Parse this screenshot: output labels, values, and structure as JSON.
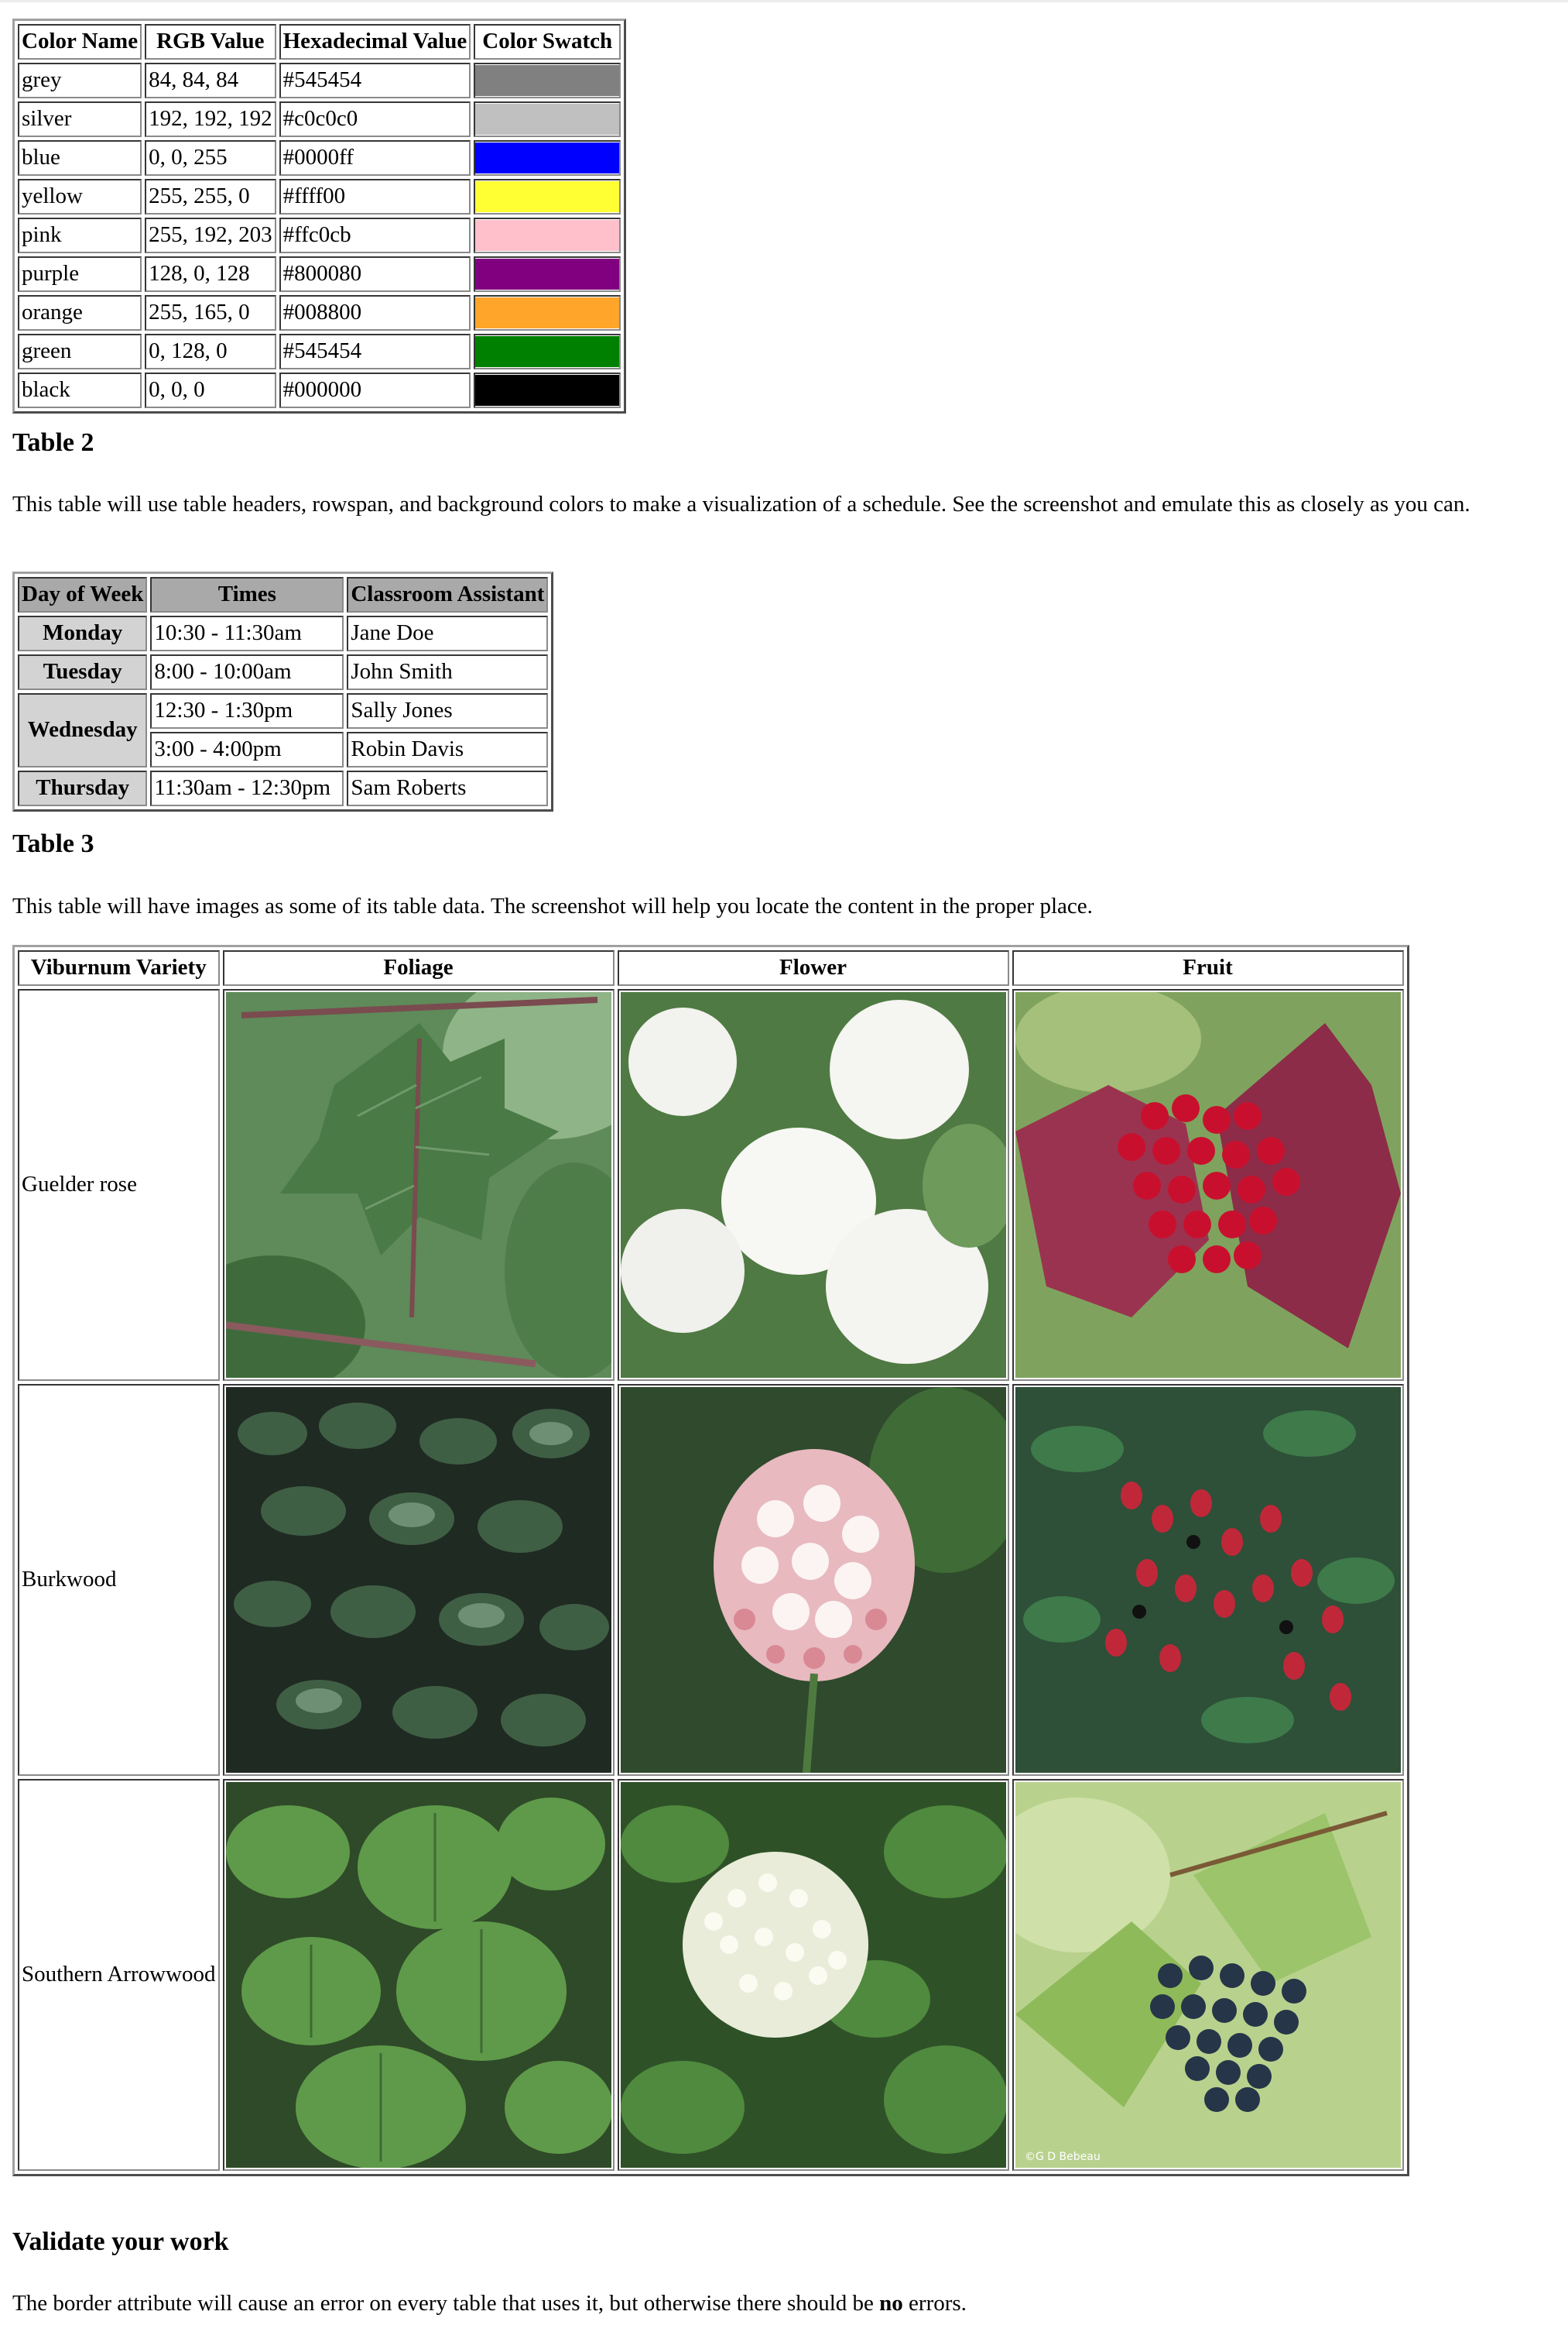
{
  "color_table": {
    "headers": [
      "Color Name",
      "RGB Value",
      "Hexadecimal Value",
      "Color Swatch"
    ],
    "rows": [
      {
        "name": "grey",
        "rgb": "84, 84, 84",
        "hex": "#545454",
        "swatch": "#808080"
      },
      {
        "name": "silver",
        "rgb": "192, 192, 192",
        "hex": "#c0c0c0",
        "swatch": "#c0c0c0"
      },
      {
        "name": "blue",
        "rgb": "0, 0, 255",
        "hex": "#0000ff",
        "swatch": "#0000ff"
      },
      {
        "name": "yellow",
        "rgb": "255, 255, 0",
        "hex": "#ffff00",
        "swatch": "#ffff33"
      },
      {
        "name": "pink",
        "rgb": "255, 192, 203",
        "hex": "#ffc0cb",
        "swatch": "#ffc0cb"
      },
      {
        "name": "purple",
        "rgb": "128, 0, 128",
        "hex": "#800080",
        "swatch": "#800080"
      },
      {
        "name": "orange",
        "rgb": "255, 165, 0",
        "hex": "#008800",
        "swatch": "#ffa52a"
      },
      {
        "name": "green",
        "rgb": "0, 128, 0",
        "hex": "#545454",
        "swatch": "#008000"
      },
      {
        "name": "black",
        "rgb": "0, 0, 0",
        "hex": "#000000",
        "swatch": "#000000"
      }
    ]
  },
  "table2": {
    "heading": "Table 2",
    "description": "This table will use table headers, rowspan, and background colors to make a visualization of a schedule. See the screenshot and emulate this as closely as you can.",
    "headers": [
      "Day of Week",
      "Times",
      "Classroom Assistant"
    ],
    "days": {
      "monday": "Monday",
      "tuesday": "Tuesday",
      "wednesday": "Wednesday",
      "thursday": "Thursday"
    },
    "rows": [
      {
        "time": "10:30 - 11:30am",
        "assistant": "Jane Doe"
      },
      {
        "time": "8:00 - 10:00am",
        "assistant": "John Smith"
      },
      {
        "time": "12:30 - 1:30pm",
        "assistant": "Sally Jones"
      },
      {
        "time": "3:00 - 4:00pm",
        "assistant": "Robin Davis"
      },
      {
        "time": "11:30am - 12:30pm",
        "assistant": "Sam Roberts"
      }
    ],
    "header_bg": "#a9a9a9",
    "row_header_bg": "#d3d3d3"
  },
  "table3": {
    "heading": "Table 3",
    "description": "This table will have images as some of its table data. The screenshot will help you locate the content in the proper place.",
    "headers": [
      "Viburnum Variety",
      "Foliage",
      "Flower",
      "Fruit"
    ],
    "rows": [
      {
        "variety": "Guelder rose"
      },
      {
        "variety": "Burkwood"
      },
      {
        "variety": "Southern Arrowwood"
      }
    ],
    "photo_credit": "©G D Bebeau"
  },
  "validate": {
    "heading": "Validate your work",
    "text_before": "The border attribute will cause an error on every table that uses it, but otherwise there should be ",
    "emphasis": "no",
    "text_after": " errors."
  }
}
